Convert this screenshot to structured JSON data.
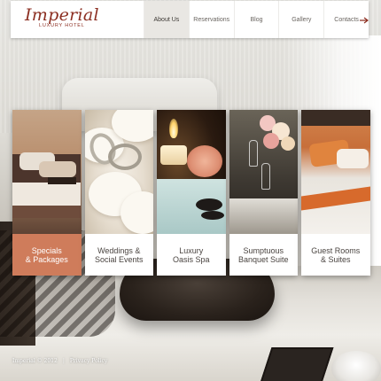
{
  "brand": {
    "title": "Imperial",
    "subtitle": "LUXURY HOTEL",
    "accent_color": "#8c2f22"
  },
  "nav": {
    "items": [
      {
        "label": "About Us",
        "active": true
      },
      {
        "label": "Reservations",
        "active": false
      },
      {
        "label": "Blog",
        "active": false
      },
      {
        "label": "Gallery",
        "active": false
      },
      {
        "label": "Contacts",
        "active": false
      }
    ]
  },
  "services": [
    {
      "line1": "Specials",
      "line2": "& Packages",
      "active": true
    },
    {
      "line1": "Weddings &",
      "line2": "Social Events",
      "active": false
    },
    {
      "line1": "Luxury",
      "line2": "Oasis Spa",
      "active": false
    },
    {
      "line1": "Sumptuous",
      "line2": "Banquet Suite",
      "active": false
    },
    {
      "line1": "Guest Rooms",
      "line2": "& Suites",
      "active": false
    }
  ],
  "highlight_color": "#cf7c5b",
  "footer": {
    "copyright": "Imperial © 2012",
    "separator": "|",
    "privacy": "Privacy Policy"
  }
}
